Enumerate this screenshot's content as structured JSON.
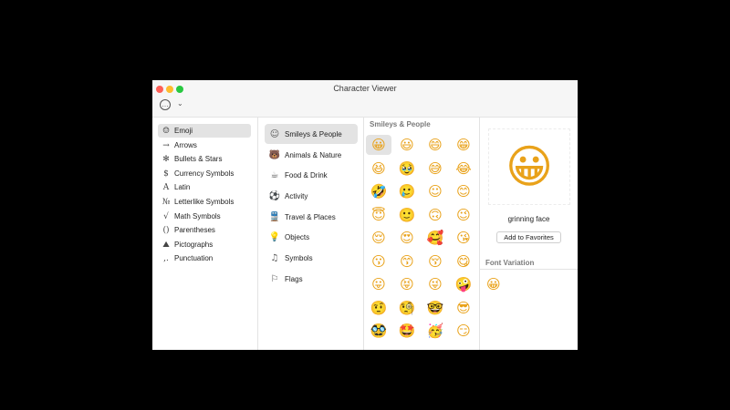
{
  "window": {
    "title": "Character Viewer"
  },
  "toolbar": {
    "action_icon": "…",
    "chevron": "⌄"
  },
  "categories": [
    {
      "icon": "☺",
      "label": "Emoji"
    },
    {
      "icon": "→",
      "label": "Arrows"
    },
    {
      "icon": "✻",
      "label": "Bullets & Stars"
    },
    {
      "icon": "$",
      "label": "Currency Symbols"
    },
    {
      "icon": "A",
      "label": "Latin"
    },
    {
      "icon": "№",
      "label": "Letterlike Symbols"
    },
    {
      "icon": "√",
      "label": "Math Symbols"
    },
    {
      "icon": "()",
      "label": "Parentheses"
    },
    {
      "icon": "⛰",
      "label": "Pictographs"
    },
    {
      "icon": ",.",
      "label": "Punctuation"
    }
  ],
  "subcategories": [
    {
      "icon": "☺",
      "label": "Smileys & People"
    },
    {
      "icon": "🐻",
      "label": "Animals & Nature"
    },
    {
      "icon": "☕",
      "label": "Food & Drink"
    },
    {
      "icon": "⚽",
      "label": "Activity"
    },
    {
      "icon": "🚆",
      "label": "Travel & Places"
    },
    {
      "icon": "💡",
      "label": "Objects"
    },
    {
      "icon": "♫",
      "label": "Symbols"
    },
    {
      "icon": "⚐",
      "label": "Flags"
    }
  ],
  "grid": {
    "title": "Smileys & People",
    "emojis": [
      "😀",
      "😃",
      "😄",
      "😁",
      "😆",
      "🥹",
      "😅",
      "😂",
      "🤣",
      "🥲",
      "☺",
      "😊",
      "😇",
      "🙂",
      "🙃",
      "😉",
      "😌",
      "😍",
      "🥰",
      "😘",
      "😗",
      "😙",
      "😚",
      "😋",
      "😛",
      "😝",
      "😜",
      "🤪",
      "🤨",
      "🧐",
      "🤓",
      "😎",
      "🥸",
      "🤩",
      "🥳",
      "😏"
    ]
  },
  "detail": {
    "glyph": "😀",
    "name": "grinning face",
    "favorites_button": "Add to Favorites",
    "font_variation_title": "Font Variation",
    "variation_glyph": "😀"
  }
}
